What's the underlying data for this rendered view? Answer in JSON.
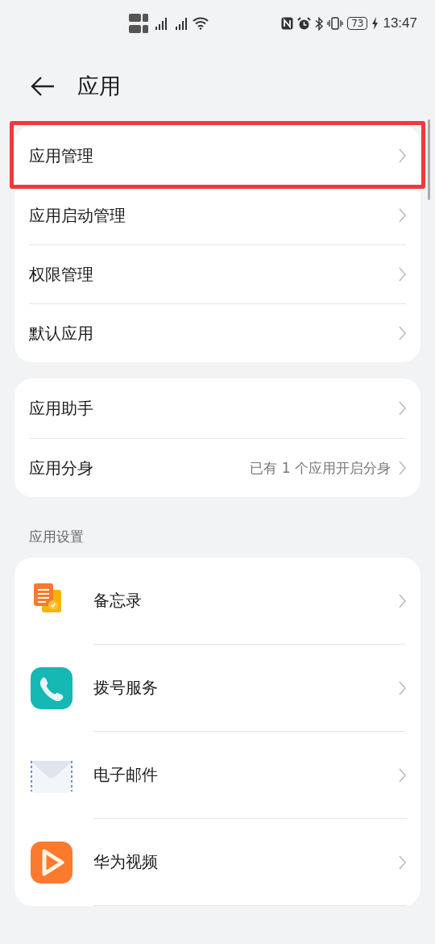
{
  "status_bar": {
    "battery": "73",
    "time": "13:47"
  },
  "header": {
    "title": "应用"
  },
  "groups": [
    {
      "items": [
        {
          "label": "应用管理",
          "highlighted": true
        },
        {
          "label": "应用启动管理",
          "highlighted": false
        },
        {
          "label": "权限管理",
          "highlighted": false
        },
        {
          "label": "默认应用",
          "highlighted": false
        }
      ]
    },
    {
      "items": [
        {
          "label": "应用助手",
          "highlighted": false
        },
        {
          "label": "应用分身",
          "value": "已有 1 个应用开启分身",
          "highlighted": false
        }
      ]
    }
  ],
  "app_settings": {
    "title": "应用设置",
    "apps": [
      {
        "name": "备忘录",
        "kind": "notes"
      },
      {
        "name": "拨号服务",
        "kind": "phone"
      },
      {
        "name": "电子邮件",
        "kind": "mail"
      },
      {
        "name": "华为视频",
        "kind": "video"
      }
    ]
  }
}
